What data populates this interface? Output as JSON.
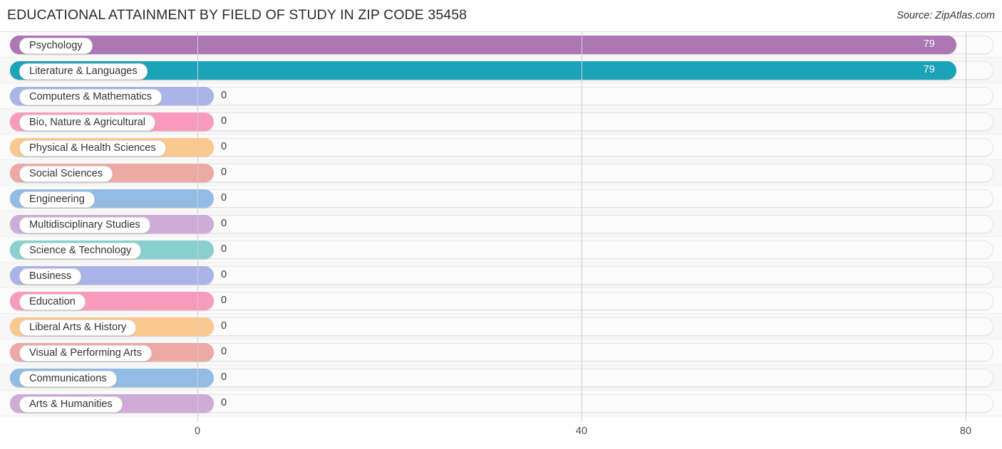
{
  "header": {
    "title": "EDUCATIONAL ATTAINMENT BY FIELD OF STUDY IN ZIP CODE 35458",
    "source": "Source: ZipAtlas.com"
  },
  "chart_data": {
    "type": "bar",
    "orientation": "horizontal",
    "title": "EDUCATIONAL ATTAINMENT BY FIELD OF STUDY IN ZIP CODE 35458",
    "subtitle": "",
    "xlabel": "",
    "ylabel": "",
    "xlim": [
      0,
      80
    ],
    "grid": true,
    "legend": null,
    "xticks": [
      0,
      40,
      80
    ],
    "xtick_labels": [
      "0",
      "40",
      "80"
    ],
    "categories": [
      "Psychology",
      "Literature & Languages",
      "Computers & Mathematics",
      "Bio, Nature & Agricultural",
      "Physical & Health Sciences",
      "Social Sciences",
      "Engineering",
      "Multidisciplinary Studies",
      "Science & Technology",
      "Business",
      "Education",
      "Liberal Arts & History",
      "Visual & Performing Arts",
      "Communications",
      "Arts & Humanities"
    ],
    "values": [
      79,
      79,
      0,
      0,
      0,
      0,
      0,
      0,
      0,
      0,
      0,
      0,
      0,
      0,
      0
    ],
    "value_labels": [
      "79",
      "79",
      "0",
      "0",
      "0",
      "0",
      "0",
      "0",
      "0",
      "0",
      "0",
      "0",
      "0",
      "0",
      "0"
    ],
    "bar_colors": [
      "#ad77b4",
      "#1ba3b9",
      "#aab4e8",
      "#f89bbd",
      "#fbc88d",
      "#eda9a4",
      "#93bce4",
      "#ceabd8",
      "#87d0cd",
      "#aab4e8",
      "#f89bbd",
      "#fbc88d",
      "#eda9a4",
      "#93bce4",
      "#ceabd8"
    ]
  },
  "colors": {
    "row_odd": "#fbfbfb",
    "row_even": "#f7f7f7",
    "gridline": "#cfcfcf",
    "track": "#fbfbfb",
    "track_border": "#e4e4e4"
  }
}
